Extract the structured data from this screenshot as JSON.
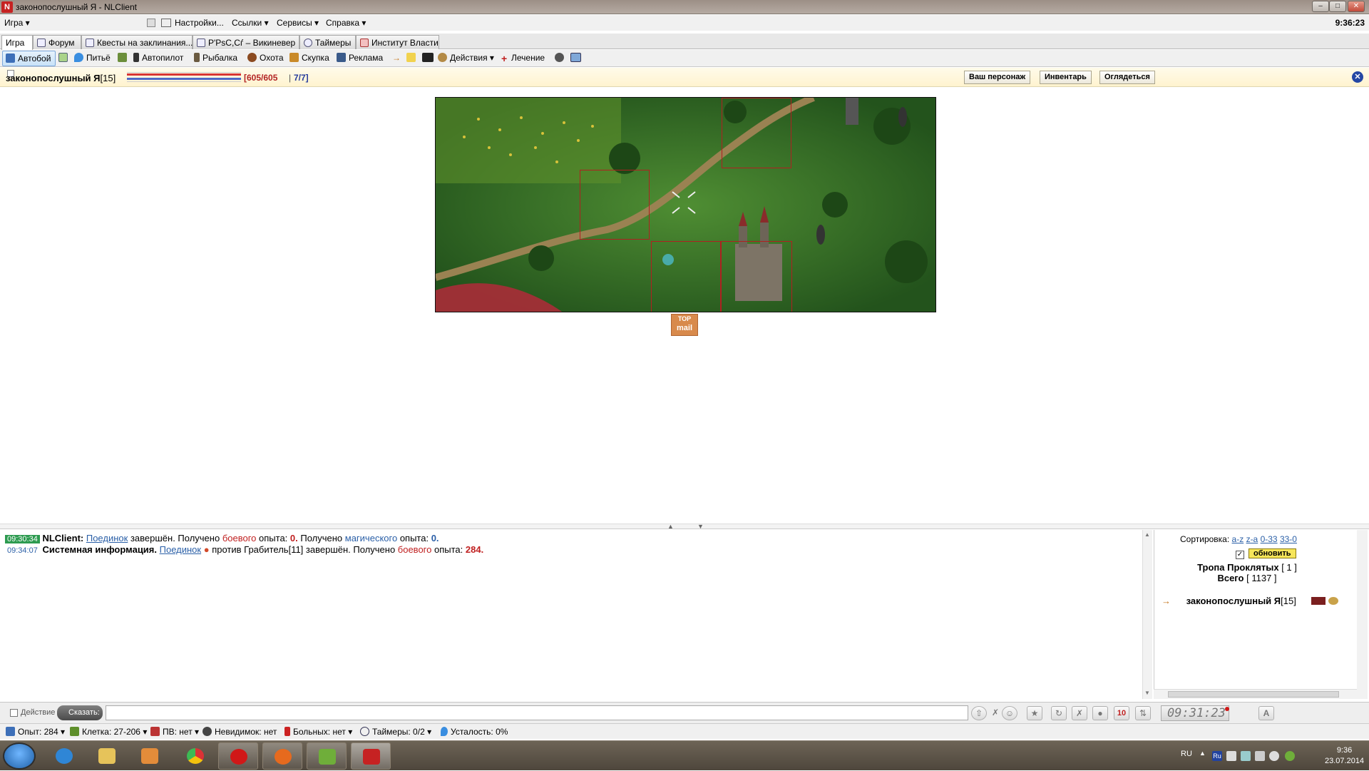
{
  "window": {
    "title": "законопослушный Я - NLClient",
    "min": "–",
    "max": "□",
    "close": "✕"
  },
  "menu": {
    "game": "Игра ▾",
    "settings": "Настройки...",
    "links": "Ссылки ▾",
    "services": "Сервисы ▾",
    "help": "Справка ▾",
    "clock": "9:36:23"
  },
  "tabs": [
    {
      "label": "Игра"
    },
    {
      "label": "Форум"
    },
    {
      "label": "Квесты на заклинания..."
    },
    {
      "label": "Р'РѕС,Сѓ – Викиневер"
    },
    {
      "label": "Таймеры"
    },
    {
      "label": "Институт Власти"
    }
  ],
  "toolbar": {
    "autoboi": "Автобой",
    "drink": "Питьё",
    "autopilot": "Автопилот",
    "fishing": "Рыбалка",
    "hunting": "Охота",
    "buying": "Скупка",
    "ads": "Реклама",
    "actions": "Действия ▾",
    "healing": "Лечение"
  },
  "character": {
    "name": "законопослушный Я",
    "level": "[15]",
    "hp": "[605/605",
    "sep": "|",
    "mp": "7/7]",
    "hp_fraction": 1.0,
    "mp_fraction": 1.0,
    "btn_character": "Ваш персонаж",
    "btn_inventory": "Инвентарь",
    "btn_look": "Оглядеться",
    "close": "✕"
  },
  "banner": {
    "line1": "TOP",
    "line2": "mail"
  },
  "chat": {
    "line1": {
      "time": "09:30:34",
      "sender": "NLClient:",
      "link": "Поединок",
      "t1": " завершён. Получено ",
      "combat": "боевого",
      "t2": " опыта: ",
      "v1": "0.",
      "t3": " Получено ",
      "magic": "магического",
      "t4": " опыта: ",
      "v2": "0."
    },
    "line2": {
      "time": "09:34:07",
      "sender": "Системная информация.",
      "link": "Поединок",
      "t1": " против Грабитель[11] завершён. Получено ",
      "combat": "боевого",
      "t2": " опыта: ",
      "v1": "284."
    }
  },
  "players": {
    "sort_label": "Сортировка:",
    "sort_az": "a-z",
    "sort_za": "z-a",
    "sort_033": "0-33",
    "sort_330": "33-0",
    "refresh": "обновить",
    "location": "Тропа Проклятых",
    "location_count": "[ 1 ]",
    "total_label": "Всего",
    "total_count": "[ 1137 ]",
    "player_name": "законопослушный Я",
    "player_level": "[15]"
  },
  "input": {
    "action_label": "Действие",
    "say": "Сказать:",
    "message": "",
    "timer": "09:31:23",
    "btn_ten": "10"
  },
  "status": {
    "exp": "Опыт: 284 ▾",
    "cell": "Клетка: 27-206 ▾",
    "pv": "ПВ: нет ▾",
    "invisible": "Невидимок: нет",
    "sick": "Больных: нет ▾",
    "timers": "Таймеры: 0/2 ▾",
    "fatigue": "Усталость: 0%"
  },
  "taskbar": {
    "lang": "RU",
    "tray_lang": "Ru",
    "time": "9:36",
    "date": "23.07.2014"
  },
  "colors": {
    "accent": "#2a5fa7",
    "hp": "#d93434",
    "mp": "#4f69c8",
    "chat_time": "#2d9b50"
  }
}
